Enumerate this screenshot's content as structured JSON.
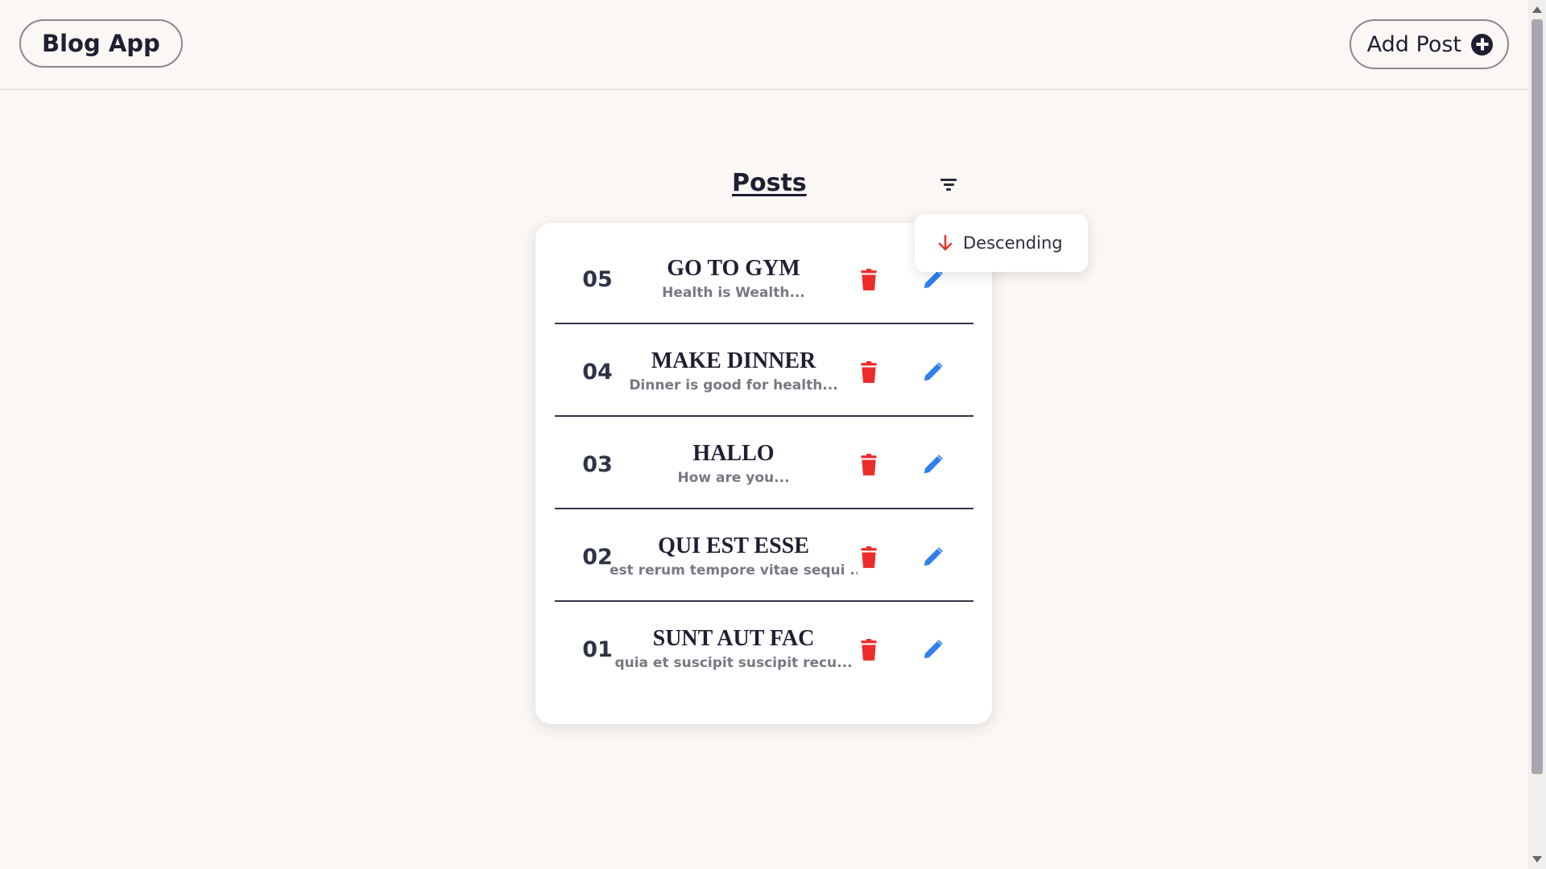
{
  "header": {
    "brand": "Blog App",
    "add_post_label": "Add Post"
  },
  "posts_section": {
    "title": "Posts",
    "sort_option": "Descending"
  },
  "posts": [
    {
      "id": "05",
      "title": "GO TO GYM",
      "body": "Health is Wealth..."
    },
    {
      "id": "04",
      "title": "MAKE DINNER",
      "body": "Dinner is good for health..."
    },
    {
      "id": "03",
      "title": "HALLO",
      "body": "How are you..."
    },
    {
      "id": "02",
      "title": "QUI EST ESSE",
      "body": "est rerum tempore vitae sequi ..."
    },
    {
      "id": "01",
      "title": "SUNT AUT FAC",
      "body": "quia et suscipit suscipit recu..."
    }
  ],
  "colors": {
    "background": "#faf7f5",
    "text": "#1f1f33",
    "delete": "#ee2b2b",
    "edit": "#2f80ed",
    "sort_arrow": "#e53935"
  },
  "icons": {
    "add": "plus-circle-icon",
    "filter": "filter-icon",
    "sort": "arrow-down-icon",
    "delete": "trash-icon",
    "edit": "pencil-icon"
  }
}
